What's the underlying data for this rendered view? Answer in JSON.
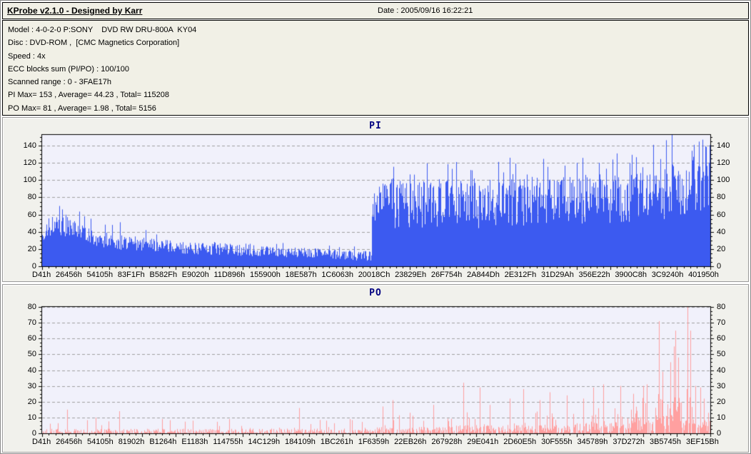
{
  "window": {
    "title": "KProbe v2.1.0 - Designed by Karr",
    "date_label": "Date : 2005/09/16 16:22:21"
  },
  "info": {
    "lines": [
      "Model : 4-0-2-0 P:SONY    DVD RW DRU-800A  KY04",
      "Disc : DVD-ROM ,  [CMC Magnetics Corporation]",
      "Speed : 4x",
      "ECC blocks sum (PI/PO) : 100/100",
      "Scanned range : 0 - 3FAE17h",
      "PI Max= 153 , Average= 44.23 , Total= 115208",
      "PO Max= 81 , Average= 1.98 , Total= 5156"
    ]
  },
  "chart_data": [
    {
      "type": "bar",
      "title": "PI",
      "xlabel": "",
      "ylabel": "",
      "ylim": [
        0,
        152.5
      ],
      "yticks": [
        0,
        20,
        40,
        60,
        80,
        100,
        120,
        140
      ],
      "ytick_minor": 5,
      "grid": "horizontal-dashed",
      "legend": "none",
      "bar_color": "#3c5af0",
      "plot_bg": "#f1f1fb",
      "grid_color": "#a0a0a0",
      "stats": {
        "max": 153,
        "average": 44.23,
        "total": 115208
      },
      "x_tick_labels": [
        "D41h",
        "26456h",
        "54105h",
        "83F1Fh",
        "B582Fh",
        "E9020h",
        "11D896h",
        "155900h",
        "18E587h",
        "1C6063h",
        "20018Ch",
        "23829Eh",
        "26F754h",
        "2A844Dh",
        "2E312Fh",
        "31D29Ah",
        "356E22h",
        "3900C8h",
        "3C9240h",
        "401950h"
      ],
      "n_bars": 936,
      "profile_segments": [
        [
          0.0,
          0.01,
          32,
          42,
          8,
          0,
          0,
          0
        ],
        [
          0.01,
          0.022,
          42,
          46,
          12,
          0.1,
          50,
          62
        ],
        [
          0.022,
          0.04,
          46,
          44,
          14,
          0.22,
          55,
          71
        ],
        [
          0.04,
          0.075,
          42,
          32,
          12,
          0.15,
          45,
          64
        ],
        [
          0.075,
          0.12,
          30,
          25,
          9,
          0.1,
          34,
          52
        ],
        [
          0.12,
          0.2,
          25,
          20,
          8,
          0.07,
          28,
          40
        ],
        [
          0.2,
          0.32,
          20,
          16,
          7,
          0.06,
          22,
          32
        ],
        [
          0.32,
          0.42,
          16,
          13,
          6,
          0.05,
          18,
          28
        ],
        [
          0.42,
          0.494,
          13,
          10,
          6,
          0.05,
          14,
          24
        ],
        [
          0.494,
          0.52,
          58,
          66,
          26,
          0.1,
          78,
          96
        ],
        [
          0.52,
          0.65,
          62,
          68,
          28,
          0.12,
          92,
          122
        ],
        [
          0.65,
          0.8,
          64,
          70,
          28,
          0.12,
          95,
          125
        ],
        [
          0.8,
          0.93,
          68,
          76,
          30,
          0.14,
          100,
          135
        ],
        [
          0.93,
          1.0,
          76,
          88,
          32,
          0.2,
          108,
          148
        ]
      ],
      "peak_spikes": [
        [
          0.026,
          70
        ],
        [
          0.03,
          66
        ],
        [
          0.063,
          58
        ],
        [
          0.105,
          48
        ],
        [
          0.155,
          42
        ],
        [
          0.36,
          27
        ],
        [
          0.43,
          24
        ],
        [
          0.62,
          121
        ],
        [
          0.7,
          126
        ],
        [
          0.8,
          120
        ],
        [
          0.86,
          131
        ],
        [
          0.915,
          141
        ],
        [
          0.942,
          153
        ],
        [
          0.975,
          141
        ],
        [
          0.988,
          147
        ]
      ]
    },
    {
      "type": "bar",
      "title": "PO",
      "xlabel": "",
      "ylabel": "",
      "ylim": [
        0,
        80
      ],
      "yticks": [
        0,
        10,
        20,
        30,
        40,
        50,
        60,
        70,
        80
      ],
      "ytick_minor": 2.5,
      "grid": "horizontal-dashed",
      "legend": "none",
      "bar_color": "#ffa0a0",
      "plot_bg": "#f1f1fb",
      "grid_color": "#a0a0a0",
      "stats": {
        "max": 81,
        "average": 1.98,
        "total": 5156
      },
      "x_tick_labels": [
        "D41h",
        "26456h",
        "54105h",
        "81902h",
        "B1264h",
        "E1183h",
        "114755h",
        "14C129h",
        "184109h",
        "1BC261h",
        "1F6359h",
        "22EB26h",
        "267928h",
        "29E041h",
        "2D60E5h",
        "30F555h",
        "345789h",
        "37D272h",
        "3B5745h",
        "3EF15Bh"
      ],
      "n_bars": 936,
      "profile_segments": [
        [
          0.0,
          0.5,
          0.3,
          0.5,
          2.0,
          0.04,
          3,
          9
        ],
        [
          0.5,
          0.62,
          0.6,
          1.0,
          2.6,
          0.07,
          4,
          12
        ],
        [
          0.62,
          0.8,
          1.0,
          1.6,
          3.2,
          0.1,
          5,
          15
        ],
        [
          0.8,
          0.88,
          1.6,
          2.4,
          4.5,
          0.13,
          6,
          18
        ],
        [
          0.88,
          0.955,
          2.5,
          3.5,
          6.5,
          0.22,
          8,
          24
        ],
        [
          0.955,
          1.0,
          2.5,
          2.5,
          5.5,
          0.18,
          8,
          20
        ]
      ],
      "peak_spikes": [
        [
          0.037,
          15
        ],
        [
          0.08,
          10
        ],
        [
          0.115,
          14
        ],
        [
          0.18,
          9
        ],
        [
          0.225,
          8
        ],
        [
          0.28,
          9
        ],
        [
          0.385,
          16
        ],
        [
          0.425,
          8
        ],
        [
          0.46,
          9
        ],
        [
          0.51,
          17
        ],
        [
          0.525,
          21
        ],
        [
          0.55,
          13
        ],
        [
          0.585,
          18
        ],
        [
          0.63,
          32
        ],
        [
          0.655,
          29
        ],
        [
          0.67,
          18
        ],
        [
          0.7,
          22
        ],
        [
          0.72,
          28
        ],
        [
          0.745,
          21
        ],
        [
          0.76,
          26
        ],
        [
          0.785,
          24
        ],
        [
          0.81,
          22
        ],
        [
          0.825,
          29
        ],
        [
          0.84,
          31
        ],
        [
          0.865,
          30
        ],
        [
          0.885,
          25
        ],
        [
          0.9,
          30
        ],
        [
          0.905,
          31
        ],
        [
          0.923,
          71
        ],
        [
          0.928,
          39
        ],
        [
          0.94,
          45
        ],
        [
          0.945,
          55
        ],
        [
          0.948,
          65
        ],
        [
          0.952,
          48
        ],
        [
          0.966,
          80
        ],
        [
          0.97,
          65
        ],
        [
          0.978,
          30
        ],
        [
          0.985,
          29
        ],
        [
          0.99,
          22
        ],
        [
          0.997,
          13
        ]
      ]
    }
  ]
}
